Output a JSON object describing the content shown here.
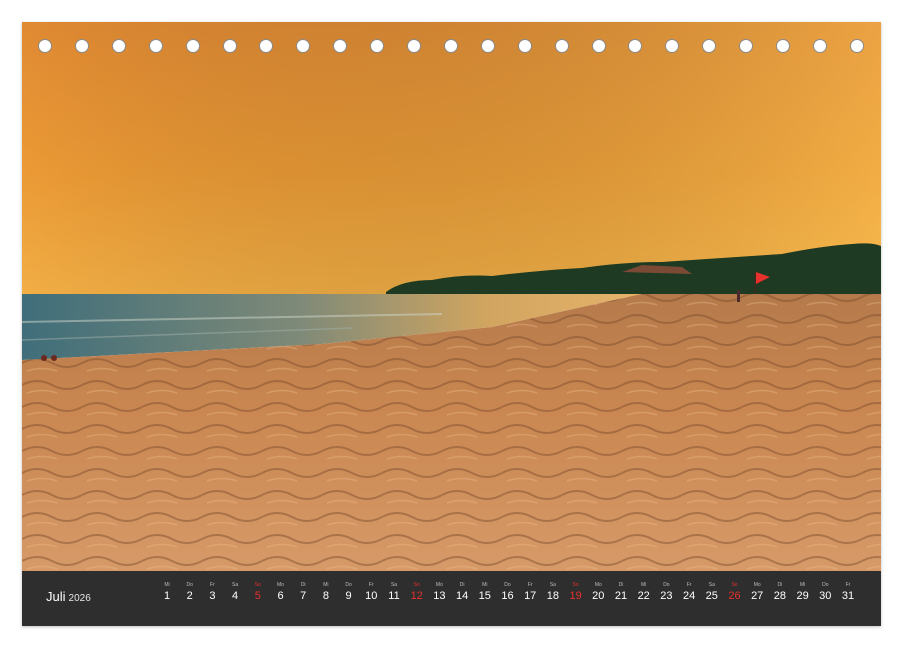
{
  "month": {
    "name": "Juli",
    "year": "2026"
  },
  "days": [
    {
      "wd": "Mi",
      "num": "1",
      "red": false
    },
    {
      "wd": "Do",
      "num": "2",
      "red": false
    },
    {
      "wd": "Fr",
      "num": "3",
      "red": false
    },
    {
      "wd": "Sa",
      "num": "4",
      "red": false
    },
    {
      "wd": "So",
      "num": "5",
      "red": true
    },
    {
      "wd": "Mo",
      "num": "6",
      "red": false
    },
    {
      "wd": "Di",
      "num": "7",
      "red": false
    },
    {
      "wd": "Mi",
      "num": "8",
      "red": false
    },
    {
      "wd": "Do",
      "num": "9",
      "red": false
    },
    {
      "wd": "Fr",
      "num": "10",
      "red": false
    },
    {
      "wd": "Sa",
      "num": "11",
      "red": false
    },
    {
      "wd": "So",
      "num": "12",
      "red": true
    },
    {
      "wd": "Mo",
      "num": "13",
      "red": false
    },
    {
      "wd": "Di",
      "num": "14",
      "red": false
    },
    {
      "wd": "Mi",
      "num": "15",
      "red": false
    },
    {
      "wd": "Do",
      "num": "16",
      "red": false
    },
    {
      "wd": "Fr",
      "num": "17",
      "red": false
    },
    {
      "wd": "Sa",
      "num": "18",
      "red": false
    },
    {
      "wd": "So",
      "num": "19",
      "red": true
    },
    {
      "wd": "Mo",
      "num": "20",
      "red": false
    },
    {
      "wd": "Di",
      "num": "21",
      "red": false
    },
    {
      "wd": "Mi",
      "num": "22",
      "red": false
    },
    {
      "wd": "Do",
      "num": "23",
      "red": false
    },
    {
      "wd": "Fr",
      "num": "24",
      "red": false
    },
    {
      "wd": "Sa",
      "num": "25",
      "red": false
    },
    {
      "wd": "So",
      "num": "26",
      "red": true
    },
    {
      "wd": "Mo",
      "num": "27",
      "red": false
    },
    {
      "wd": "Di",
      "num": "28",
      "red": false
    },
    {
      "wd": "Mi",
      "num": "29",
      "red": false
    },
    {
      "wd": "Do",
      "num": "30",
      "red": false
    },
    {
      "wd": "Fr",
      "num": "31",
      "red": false
    }
  ],
  "colors": {
    "bar": "#2e2e2e",
    "sunday": "#e8312c",
    "sky_top": "#e38a2e",
    "sand": "#c98650"
  }
}
